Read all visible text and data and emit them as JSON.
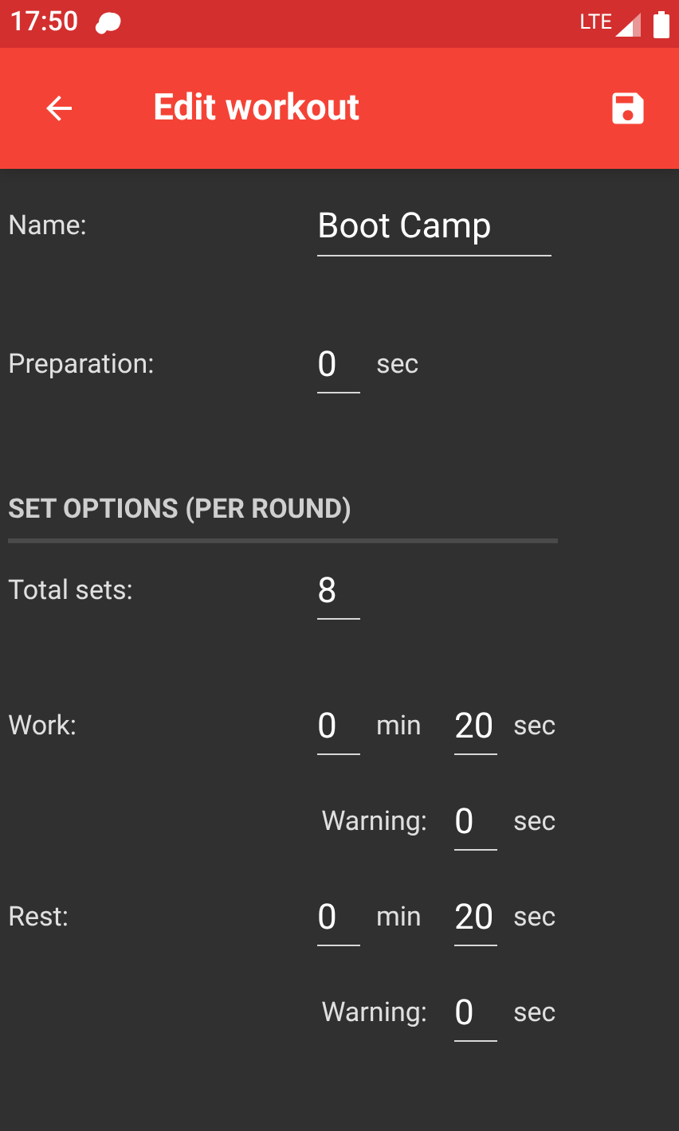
{
  "status_bar": {
    "time": "17:50",
    "network": "LTE"
  },
  "app_bar": {
    "title": "Edit workout"
  },
  "name_field": {
    "label": "Name:",
    "value": "Boot Camp"
  },
  "preparation": {
    "label": "Preparation:",
    "value": "0",
    "unit": "sec"
  },
  "section": {
    "title": "SET OPTIONS (PER ROUND)"
  },
  "rows": [
    {
      "kind": "count",
      "label": "Total sets:",
      "value": "8"
    },
    {
      "kind": "duration",
      "label": "Work:",
      "min_value": "0",
      "min_unit": "min",
      "sec_value": "20",
      "sec_unit": "sec"
    },
    {
      "kind": "warning",
      "label": "Warning:",
      "value": "0",
      "unit": "sec"
    },
    {
      "kind": "duration",
      "label": "Rest:",
      "min_value": "0",
      "min_unit": "min",
      "sec_value": "20",
      "sec_unit": "sec"
    },
    {
      "kind": "warning",
      "label": "Warning:",
      "value": "0",
      "unit": "sec"
    }
  ]
}
